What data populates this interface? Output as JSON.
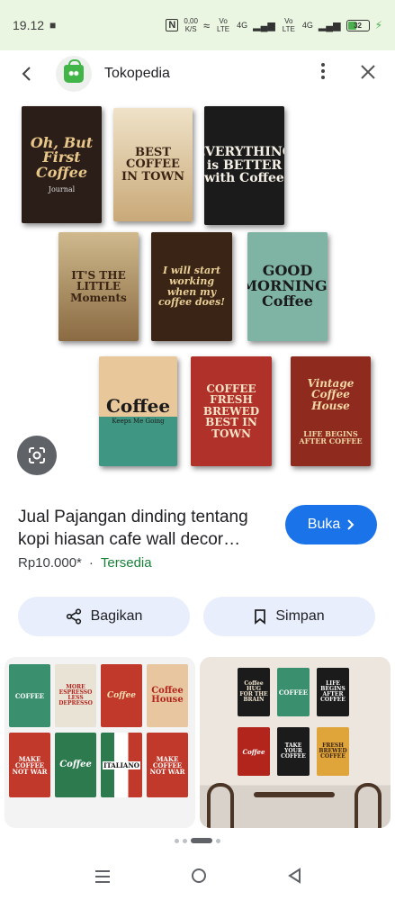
{
  "status": {
    "time": "19.12",
    "speed_value": "0,00",
    "speed_unit": "K/S",
    "net1": "4G",
    "net2": "4G",
    "lte_label": "Vo LTE",
    "battery": "32"
  },
  "header": {
    "site_name": "Tokopedia"
  },
  "posters": {
    "p1": "Oh, But First Coffee",
    "p1_sub": "Journal",
    "p2": "BEST COFFEE IN TOWN",
    "p3": "EVERYTHING is BETTER with Coffee",
    "p4": "IT'S THE LITTLE Moments",
    "p5": "I will start working when my coffee does!",
    "p6": "GOOD MORNING! Coffee",
    "p7": "Coffee",
    "p7_sub": "Keeps Me Going",
    "p8": "COFFEE FRESH BREWED BEST IN TOWN",
    "p9": "Vintage Coffee House",
    "p9_sub": "LIFE BEGINS AFTER COFFEE"
  },
  "product": {
    "title": "Jual Pajangan dinding tentang kopi hiasan cafe wall decor…",
    "price": "Rp10.000*",
    "separator": "·",
    "stock": "Tersedia",
    "open_label": "Buka",
    "share_label": "Bagikan",
    "save_label": "Simpan"
  },
  "related": {
    "r1": [
      "COFFEE",
      "MORE ESPRESSO LESS DEPRESSO",
      "Coffee",
      "Coffee House",
      "MAKE COFFEE NOT WAR",
      "Coffee",
      "ITALIANO",
      "MAKE COFFEE NOT WAR"
    ],
    "r2": [
      "Coffee HUG FOR THE BRAIN",
      "COFFEE",
      "LIFE BEGINS AFTER COFFEE",
      "Coffee",
      "TAKE YOUR COFFEE",
      "FRESH BREWED COFFEE"
    ]
  },
  "colors": {
    "accent": "#1a73e8",
    "stock_green": "#188038",
    "action_bg": "#e8eefb",
    "status_bg": "#eaf6e2"
  },
  "icons": [
    "back-arrow-icon",
    "more-vert-icon",
    "close-icon",
    "lens-icon",
    "share-icon",
    "bookmark-icon",
    "chevron-right-icon"
  ]
}
